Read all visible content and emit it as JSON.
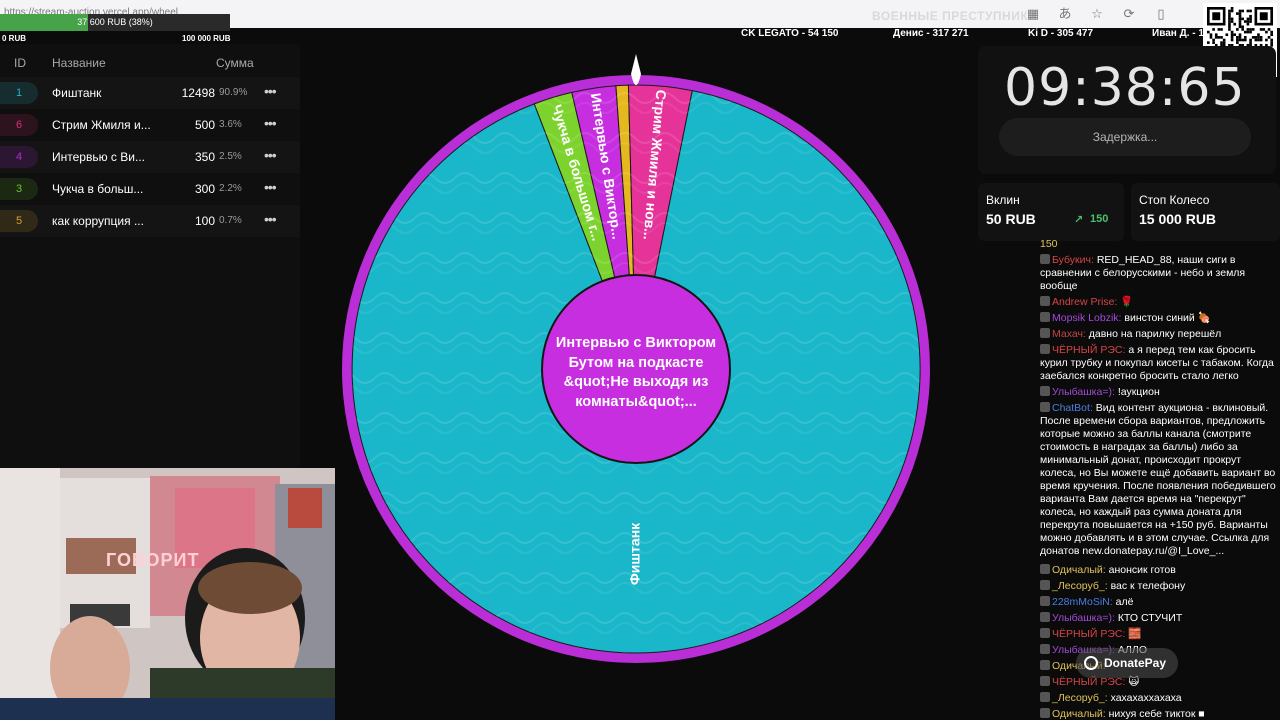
{
  "browser": {
    "url": "https://stream-auction.vercel.app/wheel",
    "page_title": "ВОЕННЫЕ ПРЕСТУПНИКИ"
  },
  "progress": {
    "label": "37 600 RUB (38%)",
    "fraction": 0.38,
    "min": "0 RUB",
    "max": "100 000 RUB"
  },
  "top_ranking": [
    {
      "text": "CK LEGATO - 54 150"
    },
    {
      "text": "Денис - 317 271"
    },
    {
      "text": "Ki D - 305 477"
    },
    {
      "text": "Иван Д. - 1"
    }
  ],
  "lots": {
    "headers": {
      "id": "ID",
      "name": "Название",
      "sum": "Сумма"
    },
    "rows": [
      {
        "id": "1",
        "name": "Фиштанк",
        "sum": "12498",
        "pct": "90.9%",
        "color": "#1fb4c7"
      },
      {
        "id": "6",
        "name": "Стрим Жмиля и...",
        "sum": "500",
        "pct": "3.6%",
        "color": "#d82e7a"
      },
      {
        "id": "4",
        "name": "Интервью с Ви...",
        "sum": "350",
        "pct": "2.5%",
        "color": "#b12bd6"
      },
      {
        "id": "3",
        "name": "Чукча в больш...",
        "sum": "300",
        "pct": "2.2%",
        "color": "#6bc12a"
      },
      {
        "id": "5",
        "name": "как коррупция ...",
        "sum": "100",
        "pct": "0.7%",
        "color": "#d5a12a"
      }
    ],
    "menu_glyph": "•••"
  },
  "webcam": {
    "neon_sign": "ГОВОРИТ"
  },
  "wheel": {
    "slices": [
      {
        "label": "Фиштанк",
        "pct": 90.9,
        "color": "#19b7c9"
      },
      {
        "label": "Стрим Жмиля и нов...",
        "pct": 3.6,
        "color": "#e5339a"
      },
      {
        "label": "",
        "pct": 0.7,
        "color": "#e6b820"
      },
      {
        "label": "Интервью с Виктор...",
        "pct": 2.5,
        "color": "#c62ee0"
      },
      {
        "label": "Чукча в большом г...",
        "pct": 2.2,
        "color": "#7dd32d"
      }
    ],
    "center_text": "Интервью с Виктором Бутом на подкасте &quot;Не выходя из комнаты&quot;...",
    "rim_color": "#b92ed6",
    "center_color": "#c62ee0"
  },
  "timer": {
    "value": "09:38:65",
    "delay_label": "Задержка..."
  },
  "cards": {
    "bet_label": "Вклин",
    "bet_value": "50 RUB",
    "bet_delta": "150",
    "stop_label": "Стоп Колесо",
    "stop_value": "15 000 RUB"
  },
  "chat": [
    {
      "nick": "",
      "text": "150",
      "nick_color": "#e0c35c"
    },
    {
      "nick": "Бубукич:",
      "text": "RED_HEAD_88, наши сиги в сравнении с белорусскими - небо и земля вообще",
      "nick_color": "#d64545"
    },
    {
      "nick": "Andrew Prise:",
      "text": "🌹",
      "nick_color": "#d64545"
    },
    {
      "nick": "Mopsik Lobzik:",
      "text": "винстон синий 🍖",
      "nick_color": "#a44ad6"
    },
    {
      "nick": "Махач:",
      "text": "давно на парилку перешёл",
      "nick_color": "#c44545"
    },
    {
      "nick": "ЧЁРНЫЙ РЭС:",
      "text": "а я перед тем как бросить курил трубку и покупал кисеты с табаком. Когда заебался конкретно бросить стало легко",
      "nick_color": "#d64545"
    },
    {
      "nick": "Улыбашка=):",
      "text": "!аукцион",
      "nick_color": "#a44ad6"
    },
    {
      "nick": "ChatBot:",
      "text": "Вид контент аукциона - вклиновый. После времени сбора вариантов, предложить которые можно за баллы канала (смотрите стоимость в наградах за баллы) либо за минимальный донат, происходит прокрут колеса, но Вы можете ещё добавить вариант во время кручения. После появления победившего варианта Вам дается время на \"перекрут\" колеса, но каждый раз сумма доната для перекрута повышается на +150 руб. Варианты можно добавлять и в этом случае. Ссылка для донатов new.donatepay.ru/@I_Love_...",
      "nick_color": "#4a7fe0"
    },
    {
      "nick": "Одичалый:",
      "text": "анонсик готов",
      "nick_color": "#e0c35c"
    },
    {
      "nick": "_Лесоруб_:",
      "text": "вас к телефону",
      "nick_color": "#e0c35c"
    },
    {
      "nick": "228mMoSiN:",
      "text": "алё",
      "nick_color": "#4a7fe0"
    },
    {
      "nick": "Улыбашка=):",
      "text": "КТО СТУЧИТ",
      "nick_color": "#a44ad6"
    },
    {
      "nick": "ЧЁРНЫЙ РЭС:",
      "text": "🧱",
      "nick_color": "#d64545"
    },
    {
      "nick": "Улыбашка=):",
      "text": "АЛЛО",
      "nick_color": "#a44ad6"
    },
    {
      "nick": "Одичалый:",
      "text": "",
      "nick_color": "#e0c35c"
    },
    {
      "nick": "ЧЁРНЫЙ РЭС:",
      "text": "🙀",
      "nick_color": "#d64545"
    },
    {
      "nick": "_Лесоруб_:",
      "text": "хахахаххахаха",
      "nick_color": "#e0c35c"
    },
    {
      "nick": "Одичалый:",
      "text": "нихуя себе тикток ■",
      "nick_color": "#e0c35c"
    }
  ],
  "donatepay": {
    "label": "DonatePay"
  }
}
